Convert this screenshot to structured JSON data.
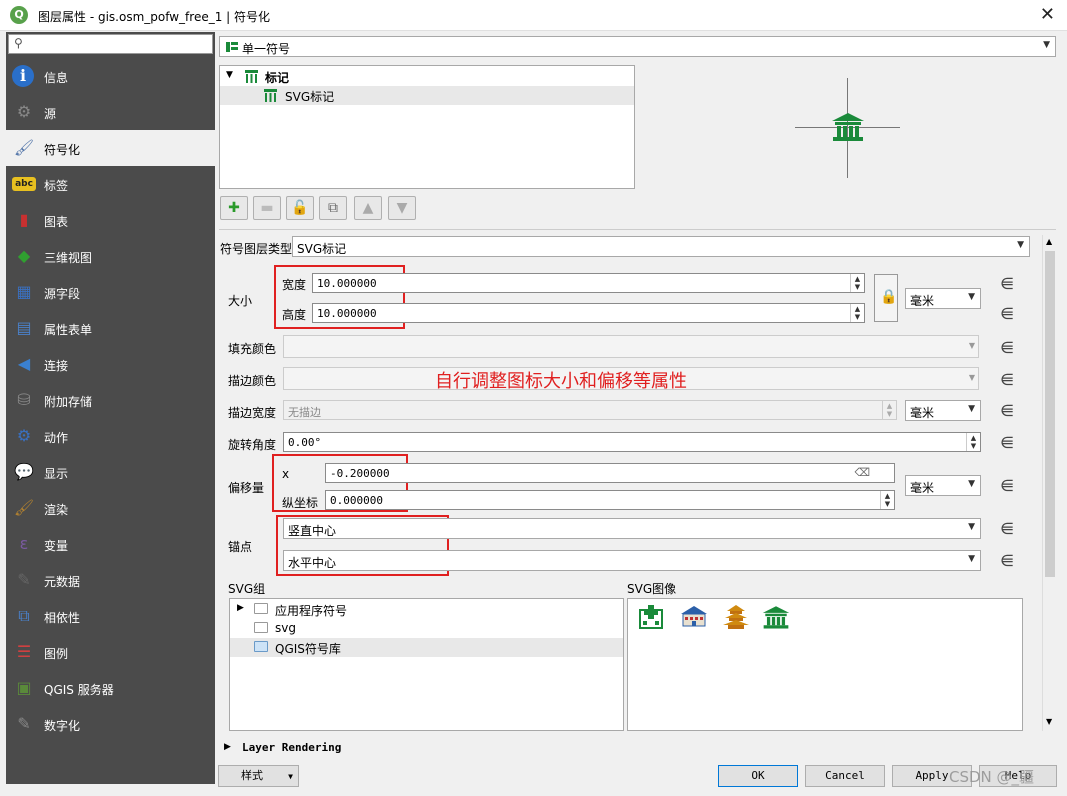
{
  "window": {
    "title": "图层属性 - gis.osm_pofw_free_1 | 符号化",
    "close_glyph": "✕"
  },
  "search": {
    "placeholder": ""
  },
  "sidebar": {
    "items": [
      {
        "label": "信息",
        "icon": "info-icon",
        "glyph": "i"
      },
      {
        "label": "源",
        "icon": "source-icon",
        "glyph": "⚙"
      },
      {
        "label": "符号化",
        "icon": "symbology-icon",
        "glyph": "🖌",
        "active": true
      },
      {
        "label": "标签",
        "icon": "labels-icon",
        "glyph": "abc"
      },
      {
        "label": "图表",
        "icon": "diagrams-icon",
        "glyph": "▮"
      },
      {
        "label": "三维视图",
        "icon": "3d-view-icon",
        "glyph": "◆"
      },
      {
        "label": "源字段",
        "icon": "fields-icon",
        "glyph": "▦"
      },
      {
        "label": "属性表单",
        "icon": "attributes-form-icon",
        "glyph": "▤"
      },
      {
        "label": "连接",
        "icon": "joins-icon",
        "glyph": "◀"
      },
      {
        "label": "附加存储",
        "icon": "auxiliary-storage-icon",
        "glyph": "⛁"
      },
      {
        "label": "动作",
        "icon": "actions-icon",
        "glyph": "⚙"
      },
      {
        "label": "显示",
        "icon": "display-icon",
        "glyph": "💬"
      },
      {
        "label": "渲染",
        "icon": "rendering-icon",
        "glyph": "🖌"
      },
      {
        "label": "变量",
        "icon": "variables-icon",
        "glyph": "ε"
      },
      {
        "label": "元数据",
        "icon": "metadata-icon",
        "glyph": "✎"
      },
      {
        "label": "相依性",
        "icon": "dependencies-icon",
        "glyph": "⧉"
      },
      {
        "label": "图例",
        "icon": "legend-icon",
        "glyph": "☰"
      },
      {
        "label": "QGIS 服务器",
        "icon": "qgis-server-icon",
        "glyph": "▣"
      },
      {
        "label": "数字化",
        "icon": "digitizing-icon",
        "glyph": "✎"
      }
    ]
  },
  "renderer": {
    "value": "单一符号",
    "icon": "single-symbol-icon"
  },
  "symbol_tree": {
    "root": "标记",
    "child": "SVG标记"
  },
  "symbol_layer_type": {
    "label": "符号图层类型",
    "value": "SVG标记"
  },
  "size": {
    "label": "大小",
    "width_label": "宽度",
    "width_value": "10.000000",
    "height_label": "高度",
    "height_value": "10.000000",
    "unit": "毫米"
  },
  "fill_color": {
    "label": "填充颜色"
  },
  "stroke_color": {
    "label": "描边颜色"
  },
  "stroke_width": {
    "label": "描边宽度",
    "value": "无描边",
    "unit": "毫米"
  },
  "rotation": {
    "label": "旋转角度",
    "value": "0.00°"
  },
  "offset": {
    "label": "偏移量",
    "x_label": "x",
    "x_value": "-0.200000",
    "y_label": "纵坐标",
    "y_value": "0.000000",
    "unit": "毫米"
  },
  "anchor": {
    "label": "锚点",
    "vertical": "竖直中心",
    "horizontal": "水平中心"
  },
  "annotation": {
    "text": "自行调整图标大小和偏移等属性",
    "color": "#e02020"
  },
  "svg_groups": {
    "label": "SVG组",
    "items": [
      "应用程序符号",
      "svg",
      "QGIS符号库"
    ]
  },
  "svg_images": {
    "label": "SVG图像",
    "icons": [
      "hospital-icon",
      "school-icon",
      "pagoda-icon",
      "temple-icon"
    ]
  },
  "layer_rendering": {
    "label": "Layer Rendering"
  },
  "buttons": {
    "style": "样式",
    "ok": "OK",
    "cancel": "Cancel",
    "apply": "Apply",
    "help": "Help"
  },
  "watermark": "CSDN @_疆",
  "colors": {
    "sidebar_bg": "#4b4b4b",
    "temple_green": "#1a8a3a",
    "accent_red": "#e02020"
  }
}
